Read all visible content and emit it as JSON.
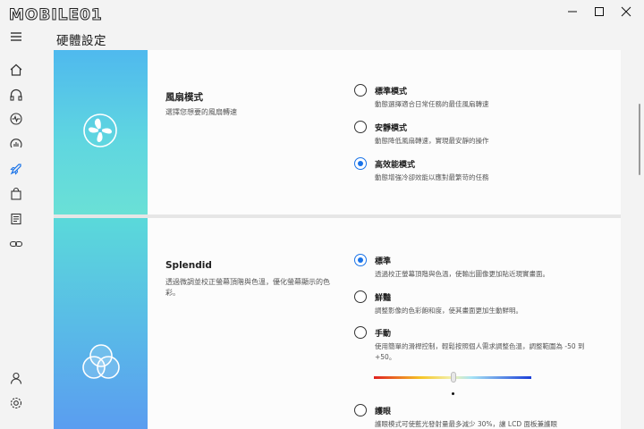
{
  "app": {
    "logo_text": "MOBILE01",
    "window_controls": {
      "minimize": "—",
      "maximize": "☐",
      "close": "✕"
    },
    "sidebar_icons": [
      "home-icon",
      "headphones-icon",
      "activity-icon",
      "monitor-stats-icon",
      "rocket-icon",
      "bag-icon",
      "document-icon",
      "link-icon",
      "user-icon",
      "settings-icon"
    ]
  },
  "page": {
    "title": "硬體設定"
  },
  "fan": {
    "title": "風扇模式",
    "desc": "選擇您想要的風扇轉速",
    "options": [
      {
        "label": "標準模式",
        "desc": "動態選擇適合日常任務的最佳風扇轉速",
        "selected": false
      },
      {
        "label": "安靜模式",
        "desc": "動態降低風扇轉速，實現最安靜的操作",
        "selected": false
      },
      {
        "label": "高效能模式",
        "desc": "動態增強冷卻效能以應對最繁苛的任務",
        "selected": true
      }
    ]
  },
  "splendid": {
    "title": "Splendid",
    "desc": "透過微調並校正螢幕頂階與色溫，優化螢幕顯示的色彩。",
    "options": [
      {
        "label": "標準",
        "desc": "透過校正螢幕頂階與色溫，使輸出圖像更加貼近現實畫面。",
        "selected": true
      },
      {
        "label": "鮮豔",
        "desc": "調整影像的色彩飽和度，使其畫面更加生動鮮明。",
        "selected": false
      },
      {
        "label": "手動",
        "desc": "使用簡單的滑桿控制，輕鬆按照個人需求調整色溫，調整範圍為 -50 到 +50。",
        "selected": false
      },
      {
        "label": "護眼",
        "desc": "護眼模式可使藍光發射量最多減少 30%，讓 LCD 面板兼護眼",
        "selected": false
      }
    ],
    "slider": {
      "min": -50,
      "max": 50,
      "value": 0
    }
  },
  "colors": {
    "accent": "#1a73e8",
    "banner_top": "#4fb9ee",
    "banner_bottom": "#5a9cf0"
  }
}
